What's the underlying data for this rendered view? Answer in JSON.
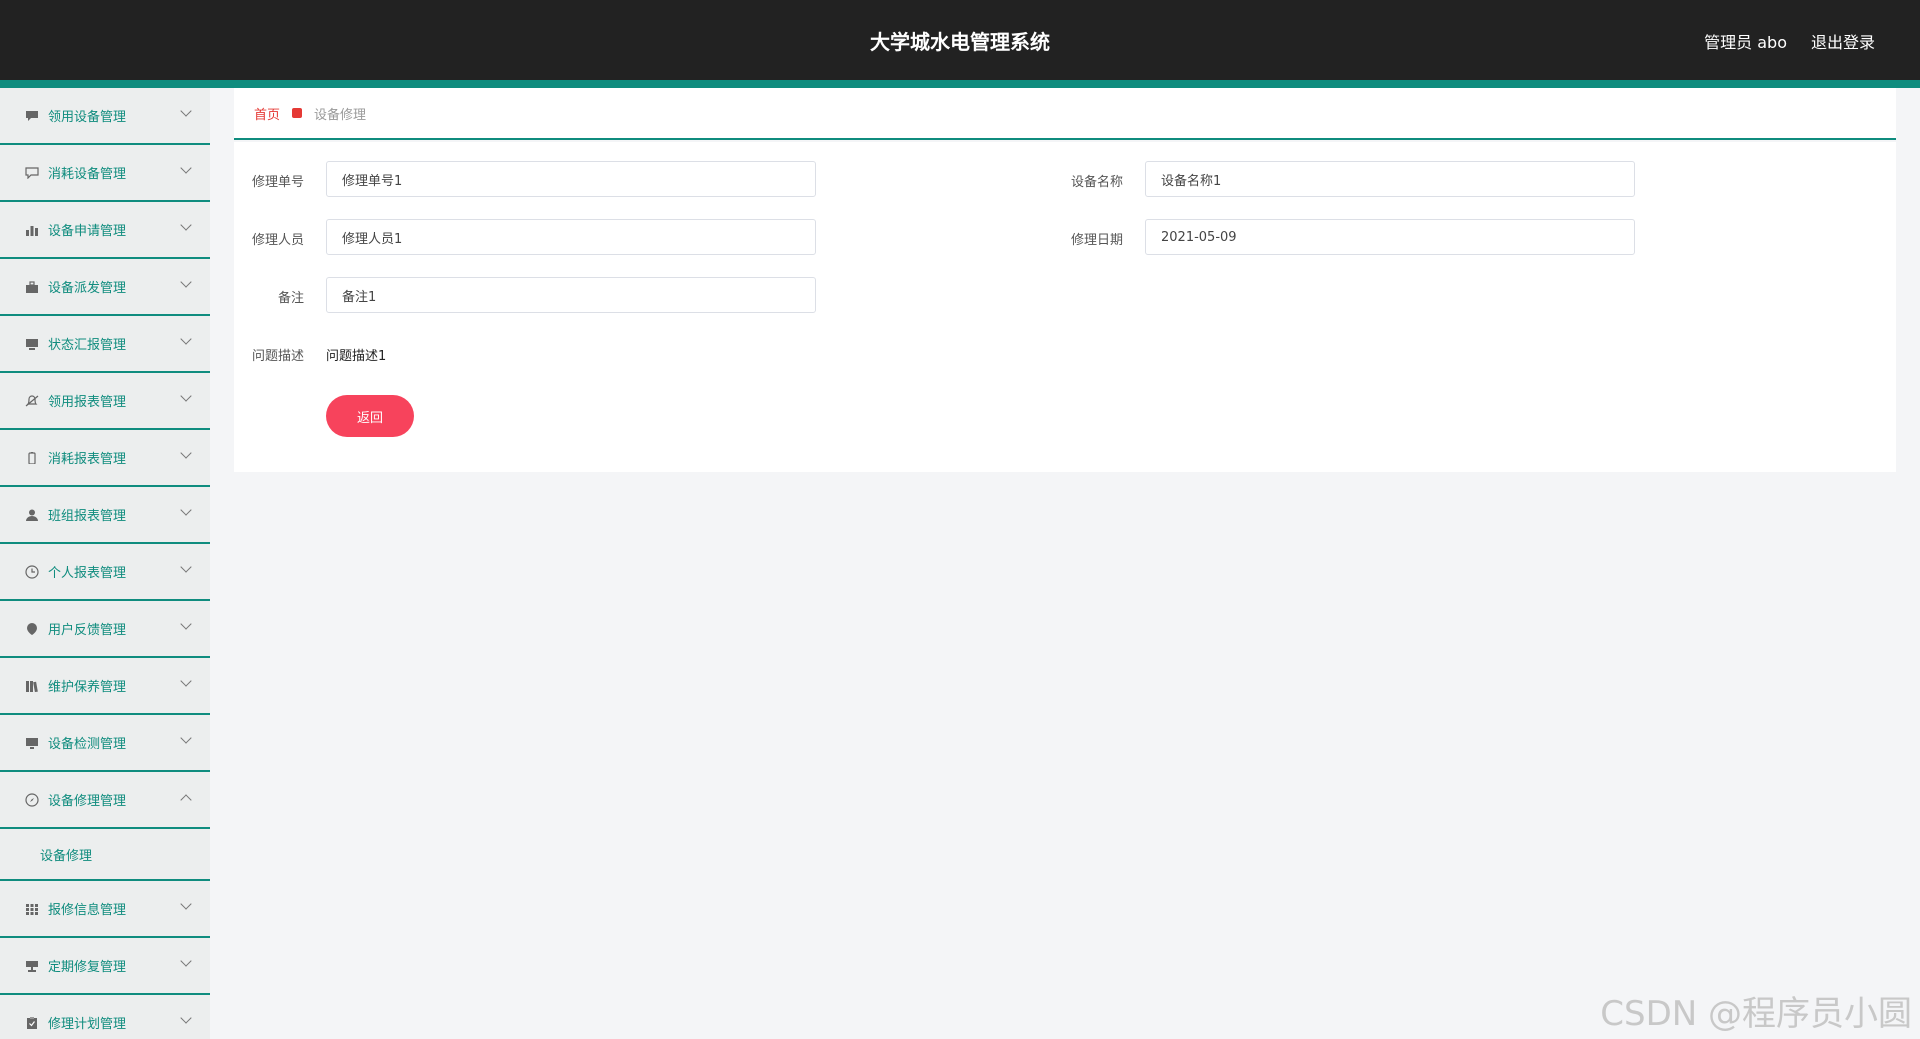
{
  "header": {
    "title": "大学城水电管理系统",
    "user": "管理员 abo",
    "logout": "退出登录"
  },
  "sidebar": {
    "items": [
      {
        "label": "领用设备管理",
        "icon": "comment-icon"
      },
      {
        "label": "消耗设备管理",
        "icon": "chat-icon"
      },
      {
        "label": "设备申请管理",
        "icon": "bar-chart-icon"
      },
      {
        "label": "设备派发管理",
        "icon": "briefcase-icon"
      },
      {
        "label": "状态汇报管理",
        "icon": "monitor-icon"
      },
      {
        "label": "领用报表管理",
        "icon": "bell-off-icon"
      },
      {
        "label": "消耗报表管理",
        "icon": "battery-icon"
      },
      {
        "label": "班组报表管理",
        "icon": "user-icon"
      },
      {
        "label": "个人报表管理",
        "icon": "clock-icon"
      },
      {
        "label": "用户反馈管理",
        "icon": "location-pin-icon"
      },
      {
        "label": "维护保养管理",
        "icon": "books-icon"
      },
      {
        "label": "设备检测管理",
        "icon": "desktop-icon"
      },
      {
        "label": "设备修理管理",
        "icon": "compass-icon",
        "expanded": true,
        "sub": "设备修理"
      },
      {
        "label": "报修信息管理",
        "icon": "grid-icon"
      },
      {
        "label": "定期修复管理",
        "icon": "display-stand-icon"
      },
      {
        "label": "修理计划管理",
        "icon": "clipboard-icon"
      }
    ]
  },
  "breadcrumb": {
    "home": "首页",
    "current": "设备修理"
  },
  "form": {
    "repair_no_label": "修理单号",
    "repair_no_value": "修理单号1",
    "device_name_label": "设备名称",
    "device_name_value": "设备名称1",
    "repairer_label": "修理人员",
    "repairer_value": "修理人员1",
    "repair_date_label": "修理日期",
    "repair_date_value": "2021-05-09",
    "remark_label": "备注",
    "remark_value": "备注1",
    "problem_label": "问题描述",
    "problem_value": "问题描述1",
    "back_button": "返回"
  },
  "watermark": "CSDN @程序员小圆",
  "colors": {
    "header_bg": "#222222",
    "accent": "#0f8c7e",
    "breadcrumb_home": "#e53935",
    "back_button": "#f7435c"
  }
}
